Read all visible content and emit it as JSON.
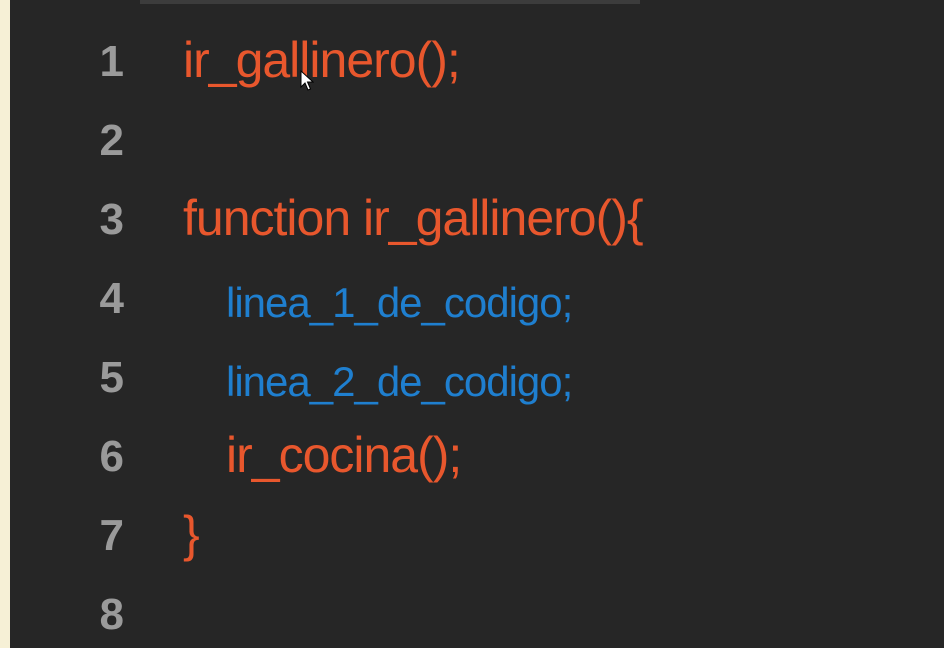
{
  "editor": {
    "colors": {
      "background": "#262626",
      "line_number": "#9a9a9a",
      "keyword_call": "#e8572d",
      "statement": "#1f7fcf"
    },
    "lines": [
      {
        "number": "1",
        "text": "ir_gallinero();",
        "color": "orange",
        "indent": false
      },
      {
        "number": "2",
        "text": "",
        "color": "orange",
        "indent": false
      },
      {
        "number": "3",
        "text": "function ir_gallinero(){",
        "color": "orange",
        "indent": false
      },
      {
        "number": "4",
        "text": "linea_1_de_codigo;",
        "color": "blue",
        "indent": true
      },
      {
        "number": "5",
        "text": "linea_2_de_codigo;",
        "color": "blue",
        "indent": true
      },
      {
        "number": "6",
        "text": "ir_cocina();",
        "color": "orange",
        "indent": true
      },
      {
        "number": "7",
        "text": "}",
        "color": "orange",
        "indent": false
      },
      {
        "number": "8",
        "text": "",
        "color": "orange",
        "indent": false
      }
    ]
  },
  "cursor": {
    "icon": "mouse-pointer-icon"
  }
}
